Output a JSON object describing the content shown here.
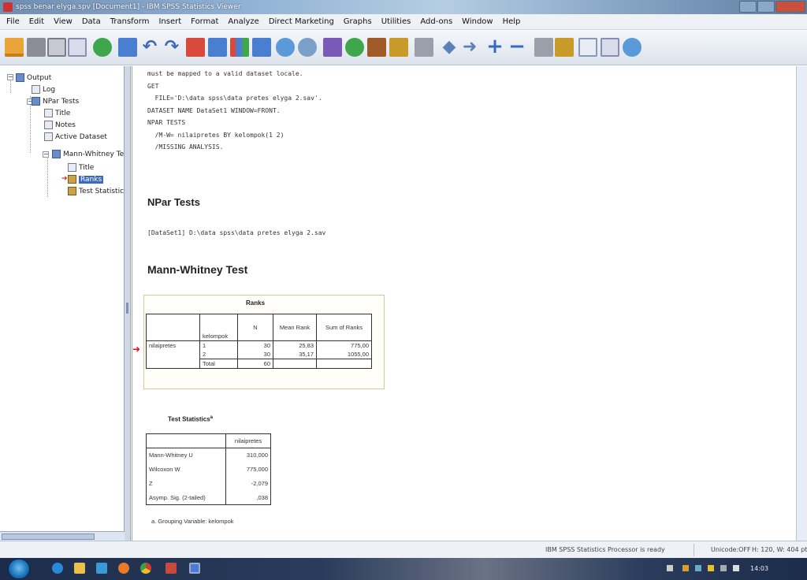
{
  "window": {
    "title": "spss benar elyga.spv [Document1] - IBM SPSS Statistics Viewer"
  },
  "menu": [
    "File",
    "Edit",
    "View",
    "Data",
    "Transform",
    "Insert",
    "Format",
    "Analyze",
    "Direct Marketing",
    "Graphs",
    "Utilities",
    "Add-ons",
    "Window",
    "Help"
  ],
  "outline": {
    "items": [
      {
        "label": "Output"
      },
      {
        "label": "Log"
      },
      {
        "label": "NPar Tests"
      },
      {
        "label": "Title"
      },
      {
        "label": "Notes"
      },
      {
        "label": "Active Dataset"
      },
      {
        "label": "Mann-Whitney Tes"
      },
      {
        "label": "Title"
      },
      {
        "label": "Ranks"
      },
      {
        "label": "Test Statistic"
      }
    ]
  },
  "syntax": {
    "lines": [
      "must be mapped to a valid dataset locale.",
      "GET",
      "  FILE='D:\\data spss\\data pretes elyga 2.sav'.",
      "DATASET NAME DataSet1 WINDOW=FRONT.",
      "NPAR TESTS",
      "  /M-W= nilaipretes BY kelompok(1 2)",
      "  /MISSING ANALYSIS."
    ]
  },
  "headings": {
    "npar": "NPar Tests",
    "dataset": "[DataSet1] D:\\data spss\\data pretes elyga 2.sav",
    "mann_whitney": "Mann-Whitney Test"
  },
  "ranks": {
    "title": "Ranks",
    "headers": {
      "group": "kelompok",
      "n": "N",
      "mean": "Mean Rank",
      "sum": "Sum of Ranks"
    },
    "variable": "nilaipretes",
    "rows": [
      {
        "group": "1",
        "n": "30",
        "mean": "25,83",
        "sum": "775,00"
      },
      {
        "group": "2",
        "n": "30",
        "mean": "35,17",
        "sum": "1055,00"
      },
      {
        "group": "Total",
        "n": "60",
        "mean": "",
        "sum": ""
      }
    ]
  },
  "test_stats": {
    "title": "Test Statistics",
    "superscript": "a",
    "column": "nilaipretes",
    "rows": [
      {
        "label": "Mann-Whitney U",
        "value": "310,000"
      },
      {
        "label": "Wilcoxon W",
        "value": "775,000"
      },
      {
        "label": "Z",
        "value": "-2,079"
      },
      {
        "label": "Asymp. Sig. (2-tailed)",
        "value": ",038"
      }
    ],
    "footnote": "a. Grouping Variable: kelompok"
  },
  "status": {
    "processor": "IBM SPSS Statistics Processor is ready",
    "unicode": "Unicode:OFF",
    "dims": "H: 120, W: 404 pt"
  },
  "taskbar": {
    "clock": "14:03"
  }
}
